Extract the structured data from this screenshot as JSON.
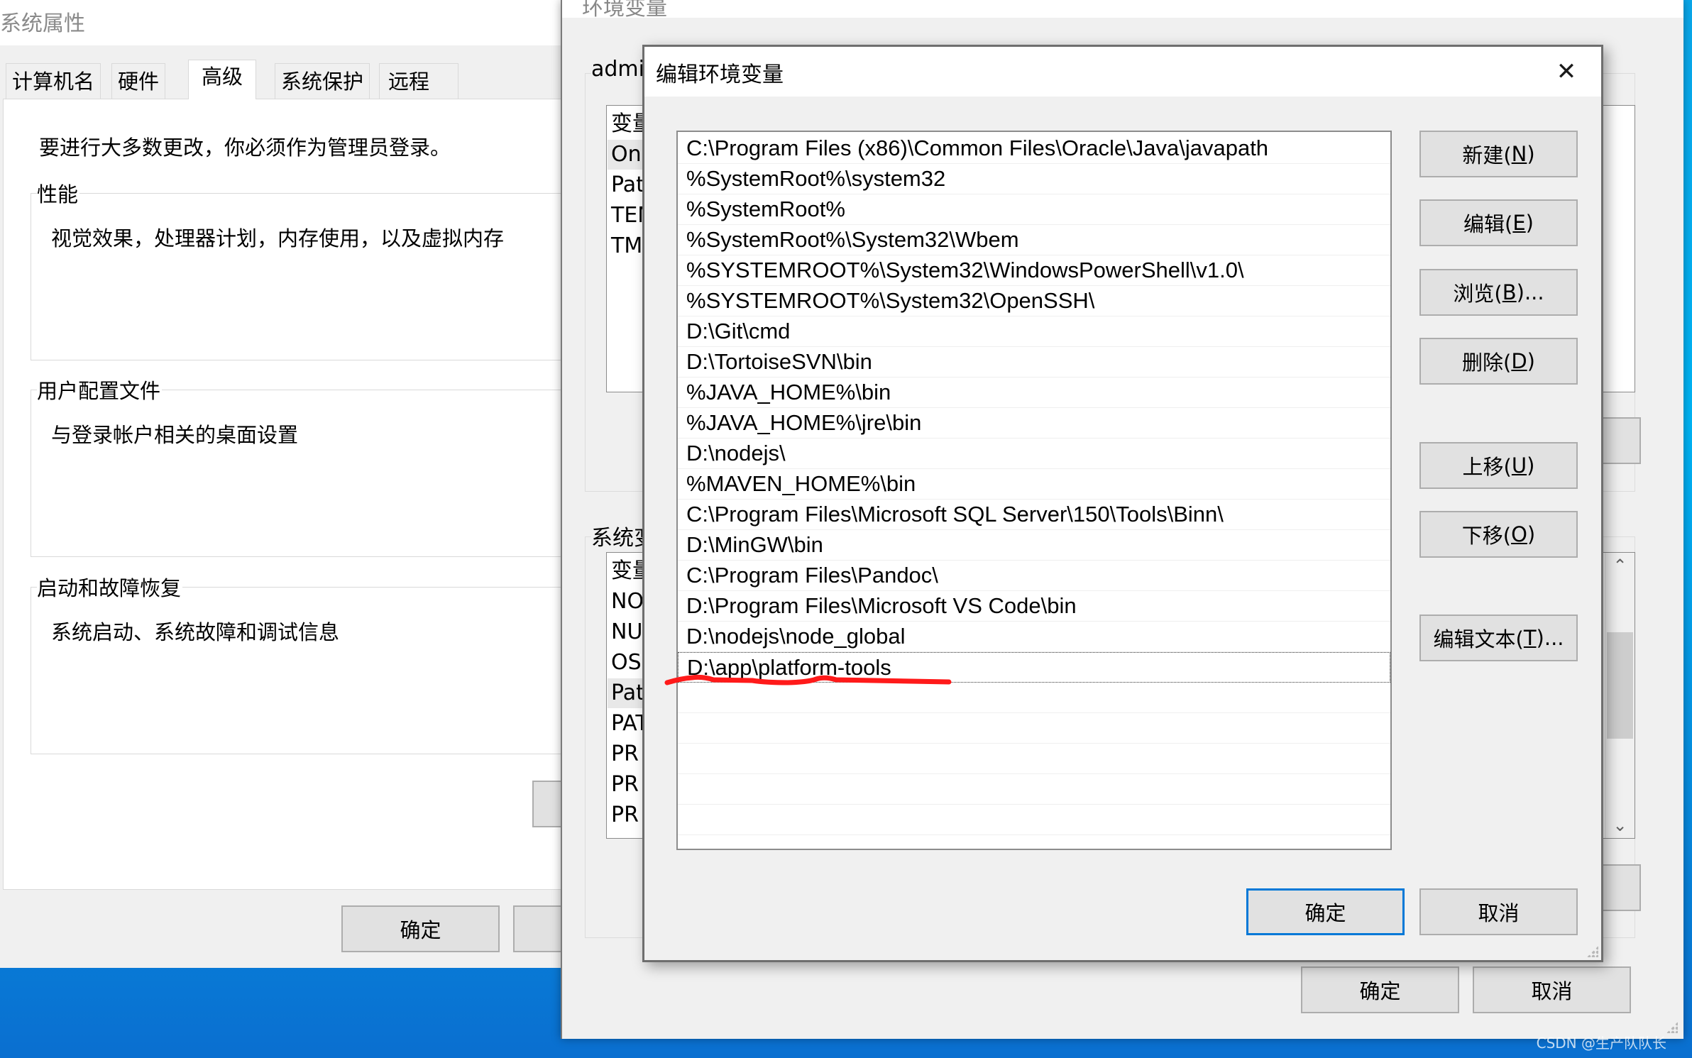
{
  "system_properties": {
    "title": "系统属性",
    "tabs": [
      {
        "label": "计算机名",
        "active": false
      },
      {
        "label": "硬件",
        "active": false
      },
      {
        "label": "高级",
        "active": true
      },
      {
        "label": "系统保护",
        "active": false
      },
      {
        "label": "远程",
        "active": false
      }
    ],
    "admin_note": "要进行大多数更改，你必须作为管理员登录。",
    "groups": [
      {
        "title": "性能",
        "description": "视觉效果，处理器计划，内存使用，以及虚拟内存"
      },
      {
        "title": "用户配置文件",
        "description": "与登录帐户相关的桌面设置"
      },
      {
        "title": "启动和故障恢复",
        "description": "系统启动、系统故障和调试信息"
      }
    ],
    "ok_label": "确定"
  },
  "env_window": {
    "title": "环境变量",
    "user_group_label": "admi",
    "user_list_header": "变量",
    "user_rows": [
      "On",
      "Pat",
      "TEM",
      "TM"
    ],
    "user_selected_index": 0,
    "system_group_label": "系统变",
    "system_list_header": "变量",
    "system_rows": [
      "NO",
      "NU",
      "OS",
      "Pat",
      "PAT",
      "PR",
      "PR",
      "PR"
    ],
    "system_selected_index": 3,
    "ok_label": "确定",
    "cancel_label": "取消"
  },
  "edit_dialog": {
    "title": "编辑环境变量",
    "close_icon": "close-icon",
    "paths": [
      "C:\\Program Files (x86)\\Common Files\\Oracle\\Java\\javapath",
      "%SystemRoot%\\system32",
      "%SystemRoot%",
      "%SystemRoot%\\System32\\Wbem",
      "%SYSTEMROOT%\\System32\\WindowsPowerShell\\v1.0\\",
      "%SYSTEMROOT%\\System32\\OpenSSH\\",
      "D:\\Git\\cmd",
      "D:\\TortoiseSVN\\bin",
      "%JAVA_HOME%\\bin",
      "%JAVA_HOME%\\jre\\bin",
      "D:\\nodejs\\",
      "%MAVEN_HOME%\\bin",
      "C:\\Program Files\\Microsoft SQL Server\\150\\Tools\\Binn\\",
      "D:\\MinGW\\bin",
      "C:\\Program Files\\Pandoc\\",
      "D:\\Program Files\\Microsoft VS Code\\bin",
      "D:\\nodejs\\node_global",
      "D:\\app\\platform-tools"
    ],
    "editing_index": 17,
    "empty_rows": 5,
    "annotation_color": "#ff1a1a",
    "buttons": {
      "new": {
        "text": "新建(",
        "key": "N",
        "suffix": ")"
      },
      "edit": {
        "text": "编辑(",
        "key": "E",
        "suffix": ")"
      },
      "browse": {
        "text": "浏览(",
        "key": "B",
        "suffix": ")..."
      },
      "delete": {
        "text": "删除(",
        "key": "D",
        "suffix": ")"
      },
      "move_up": {
        "text": "上移(",
        "key": "U",
        "suffix": ")"
      },
      "move_down": {
        "text": "下移(",
        "key": "O",
        "suffix": ")"
      },
      "edit_text": {
        "text": "编辑文本(",
        "key": "T",
        "suffix": ")..."
      }
    },
    "ok_label": "确定",
    "cancel_label": "取消"
  },
  "watermark": "CSDN @生产队队长",
  "colors": {
    "accent": "#0078d7",
    "dialog_bg": "#f0f0f0",
    "button_bg": "#e1e1e1",
    "desktop": "#00b4f4"
  }
}
